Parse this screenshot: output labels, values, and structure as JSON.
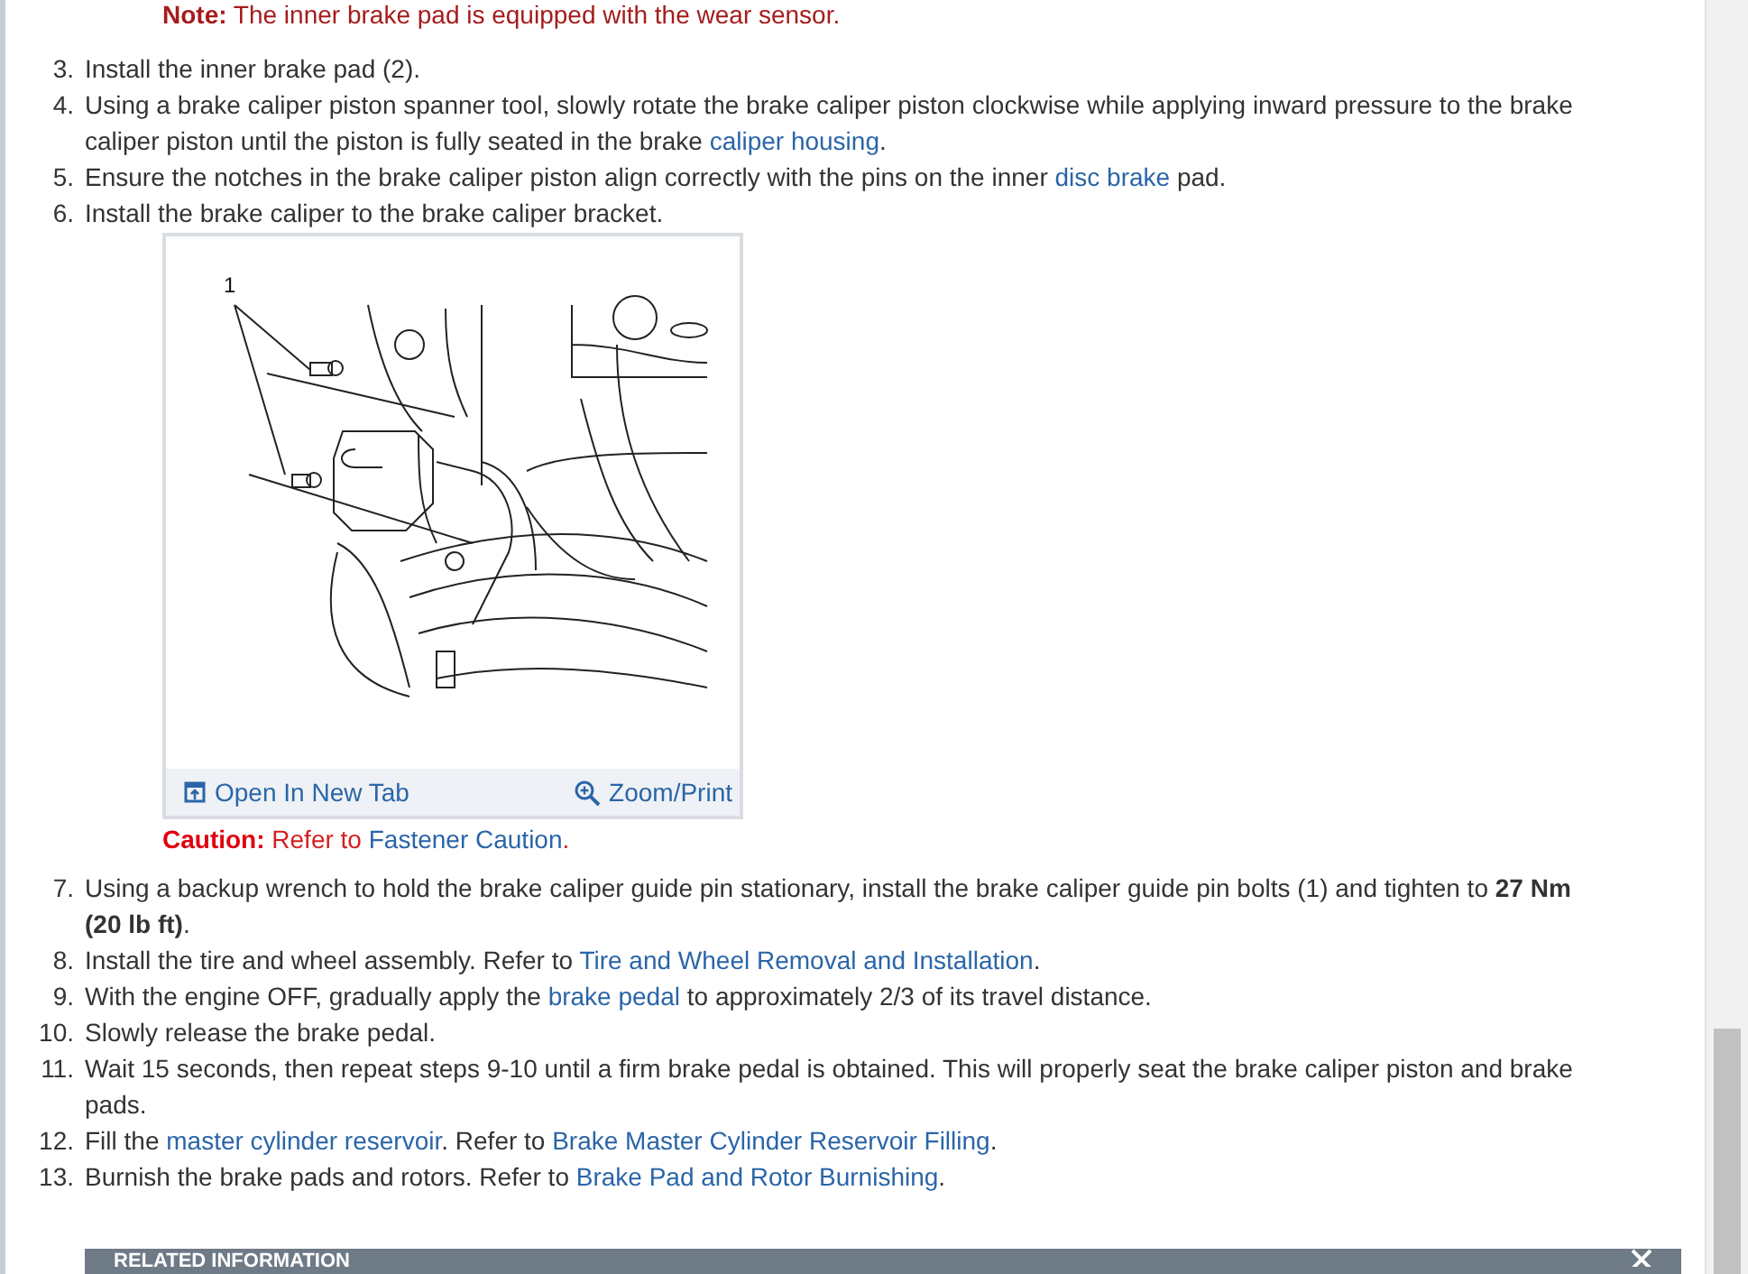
{
  "note": {
    "label": "Note:",
    "text": "The inner brake pad is equipped with the wear sensor."
  },
  "steps_before": [
    {
      "number": "3.",
      "parts": [
        {
          "kind": "text",
          "text": "Install the inner brake pad (2)."
        }
      ]
    },
    {
      "number": "4.",
      "parts": [
        {
          "kind": "text",
          "text": "Using a brake caliper piston spanner tool, slowly rotate the brake caliper piston clockwise while applying inward pressure to the brake caliper piston until the piston is fully seated in the brake "
        },
        {
          "kind": "link",
          "text": "caliper housing"
        },
        {
          "kind": "text",
          "text": "."
        }
      ]
    },
    {
      "number": "5.",
      "parts": [
        {
          "kind": "text",
          "text": "Ensure the notches in the brake caliper piston align correctly with the pins on the inner "
        },
        {
          "kind": "link",
          "text": "disc brake"
        },
        {
          "kind": "text",
          "text": " pad."
        }
      ]
    },
    {
      "number": "6.",
      "parts": [
        {
          "kind": "text",
          "text": "Install the brake caliper to the brake caliper bracket."
        }
      ]
    }
  ],
  "figure": {
    "callout": "1",
    "actions": [
      {
        "kind": "open-tab",
        "label": "Open In New Tab"
      },
      {
        "kind": "zoom",
        "label": "Zoom/Print"
      }
    ]
  },
  "caution": {
    "label": "Caution:",
    "parts": [
      {
        "kind": "text",
        "text": "Refer to "
      },
      {
        "kind": "link",
        "text": "Fastener Caution"
      },
      {
        "kind": "text",
        "text": "."
      }
    ]
  },
  "steps_after": [
    {
      "number": "7.",
      "parts": [
        {
          "kind": "text",
          "text": "Using a backup wrench to hold the brake caliper guide pin stationary, install the brake caliper guide pin bolts (1) and tighten to **27 Nm (20 lb ft)**."
        }
      ]
    },
    {
      "number": "8.",
      "parts": [
        {
          "kind": "text",
          "text": "Install the tire and wheel assembly. Refer to "
        },
        {
          "kind": "link",
          "text": "Tire and Wheel Removal and Installation"
        },
        {
          "kind": "text",
          "text": "."
        }
      ]
    },
    {
      "number": "9.",
      "parts": [
        {
          "kind": "text",
          "text": "With the engine OFF, gradually apply the "
        },
        {
          "kind": "link",
          "text": "brake pedal"
        },
        {
          "kind": "text",
          "text": " to approximately 2/3 of its travel distance."
        }
      ]
    },
    {
      "number": "10.",
      "parts": [
        {
          "kind": "text",
          "text": "Slowly release the brake pedal."
        }
      ]
    },
    {
      "number": "11.",
      "parts": [
        {
          "kind": "text",
          "text": "Wait 15 seconds, then repeat steps 9-10 until a firm brake pedal is obtained. This will properly seat the brake caliper piston and brake pads."
        }
      ]
    },
    {
      "number": "12.",
      "parts": [
        {
          "kind": "text",
          "text": "Fill the "
        },
        {
          "kind": "link",
          "text": "master cylinder reservoir"
        },
        {
          "kind": "text",
          "text": ". Refer to "
        },
        {
          "kind": "link",
          "text": "Brake Master Cylinder Reservoir Filling"
        },
        {
          "kind": "text",
          "text": "."
        }
      ]
    },
    {
      "number": "13.",
      "parts": [
        {
          "kind": "text",
          "text": "Burnish the brake pads and rotors. Refer to "
        },
        {
          "kind": "link",
          "text": "Brake Pad and Rotor Burnishing"
        },
        {
          "kind": "text",
          "text": "."
        }
      ]
    }
  ],
  "related": {
    "title": "RELATED INFORMATION"
  }
}
